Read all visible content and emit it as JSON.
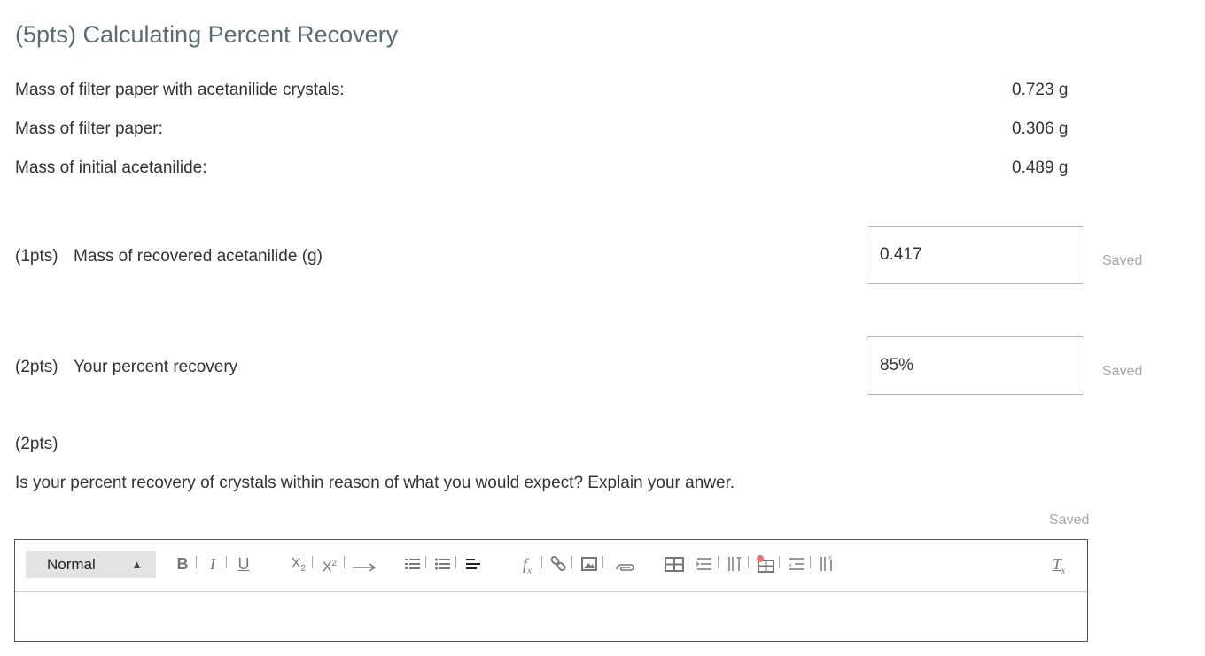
{
  "section": {
    "title": "(5pts) Calculating Percent Recovery"
  },
  "data_rows": [
    {
      "label": "Mass of filter paper with acetanilide crystals:",
      "value": "0.723 g"
    },
    {
      "label": "Mass of filter paper:",
      "value": "0.306 g"
    },
    {
      "label": "Mass of initial acetanilide:",
      "value": "0.489 g"
    }
  ],
  "questions": [
    {
      "points": "(1pts)",
      "prompt": "Mass of recovered acetanilide (g)",
      "answer": "0.417",
      "status": "Saved"
    },
    {
      "points": "(2pts)",
      "prompt": "Your percent recovery",
      "answer": "85%",
      "status": "Saved"
    }
  ],
  "essay": {
    "points": "(2pts)",
    "prompt": "Is your percent recovery of crystals within reason of what you would expect? Explain your anwer.",
    "status": "Saved",
    "format_value": "Normal",
    "body_text": ""
  },
  "toolbar_icons": [
    "bold-icon",
    "italic-icon",
    "underline-icon",
    "subscript-icon",
    "superscript-icon",
    "arrow-icon",
    "ordered-list-icon",
    "bullet-list-icon",
    "align-icon",
    "formula-icon",
    "link-icon",
    "image-icon",
    "attachment-icon",
    "table-icon",
    "insert-row-icon",
    "insert-column-icon",
    "delete-table-icon",
    "delete-row-icon",
    "delete-column-icon",
    "clear-format-icon"
  ]
}
